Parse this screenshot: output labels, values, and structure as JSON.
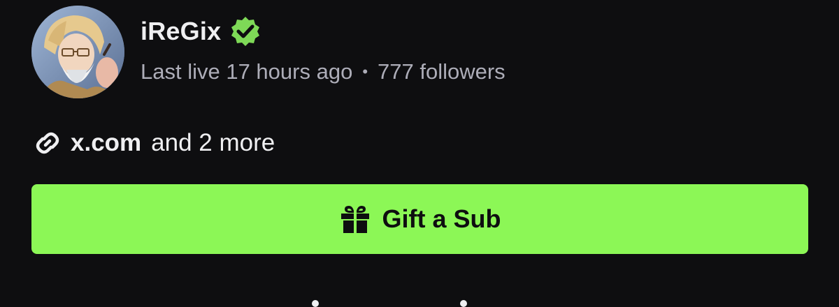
{
  "channel": {
    "name": "iReGix",
    "last_live": "Last live 17 hours ago",
    "separator": "•",
    "followers": "777 followers",
    "verified_icon": "verified-badge-icon",
    "avatar_icon": "avatar"
  },
  "links": {
    "icon": "link-icon",
    "primary": "x.com",
    "more": "and 2 more"
  },
  "gift_button": {
    "icon": "gift-icon",
    "label": "Gift a Sub"
  },
  "colors": {
    "background": "#0e0e10",
    "accent_green": "#8cf756",
    "verified_green": "#7ed957",
    "text_primary": "#efeff1",
    "text_secondary": "#adadb8"
  }
}
